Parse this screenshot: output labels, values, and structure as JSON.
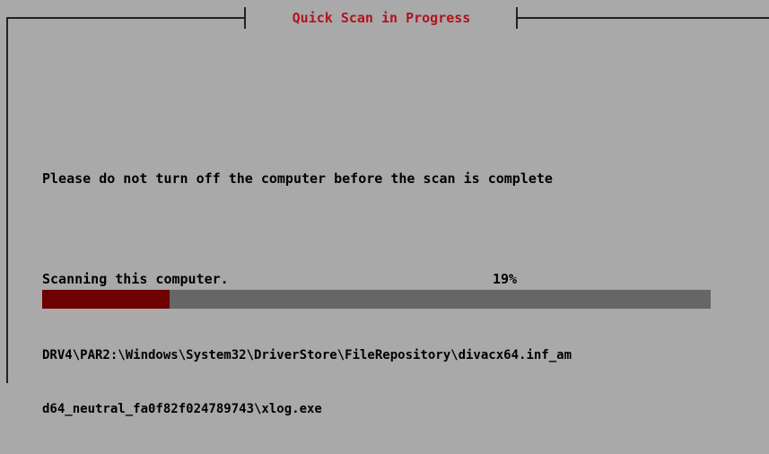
{
  "window": {
    "title": "Quick Scan in Progress"
  },
  "message": {
    "warning": "Please do not turn off the computer before the scan is complete"
  },
  "scan": {
    "status_text": "Scanning this computer.",
    "progress_label": "19%",
    "progress_value": 0.19,
    "current_file_line1": "DRV4\\PAR2:\\Windows\\System32\\DriverStore\\FileRepository\\divacx64.inf_am",
    "current_file_line2": "d64_neutral_fa0f82f024789743\\xlog.exe"
  },
  "colors": {
    "background": "#a9a9a9",
    "title": "#b0141d",
    "progress_fill": "#6f0000",
    "progress_track": "#666666",
    "text": "#000000"
  }
}
